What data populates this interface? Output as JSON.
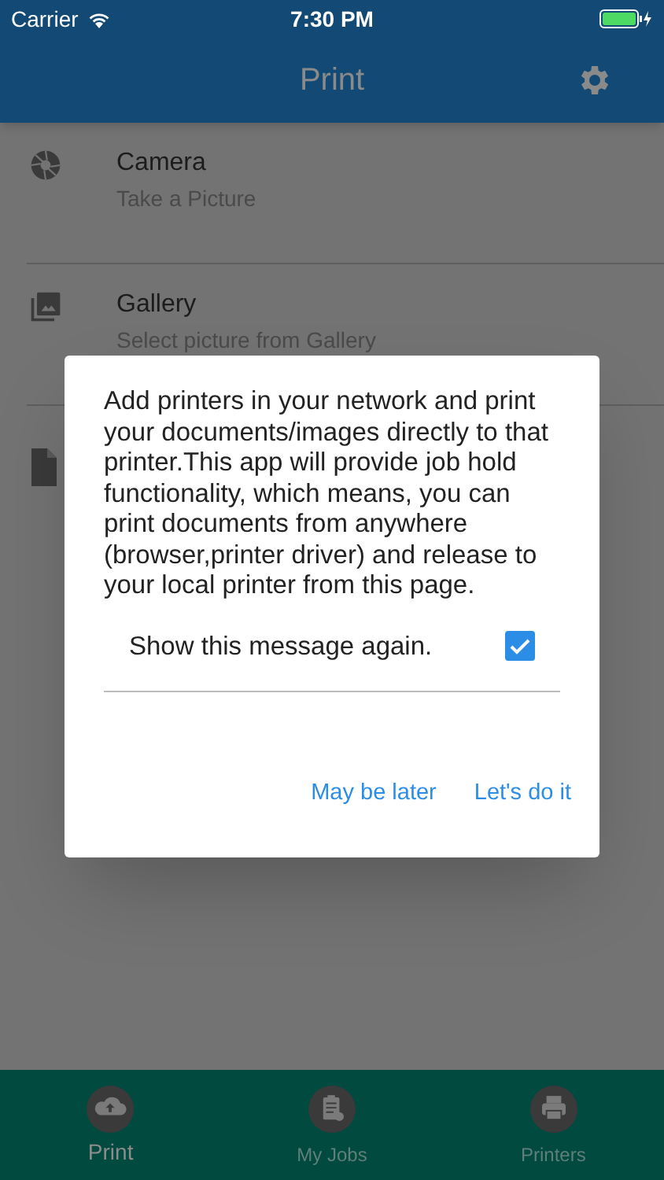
{
  "status_bar": {
    "carrier": "Carrier",
    "time": "7:30 PM"
  },
  "header": {
    "title": "Print"
  },
  "options": [
    {
      "kind": "camera",
      "title": "Camera",
      "subtitle": "Take a Picture"
    },
    {
      "kind": "gallery",
      "title": "Gallery",
      "subtitle": "Select picture from Gallery"
    },
    {
      "kind": "document"
    }
  ],
  "dialog": {
    "message": "Add printers in your network and print your documents/images directly to that printer.This app will provide job hold functionality, which means, you can print documents from anywhere (browser,printer driver) and release to your local printer from this page.",
    "checkbox": {
      "label": "Show this message again.",
      "checked": true
    },
    "actions": [
      "May be later",
      "Let's do it"
    ]
  },
  "tabs": [
    {
      "kind": "upload",
      "label": "Print",
      "selected": true
    },
    {
      "kind": "jobs",
      "label": "My Jobs",
      "selected": false
    },
    {
      "kind": "printer",
      "label": "Printers",
      "selected": false
    }
  ]
}
